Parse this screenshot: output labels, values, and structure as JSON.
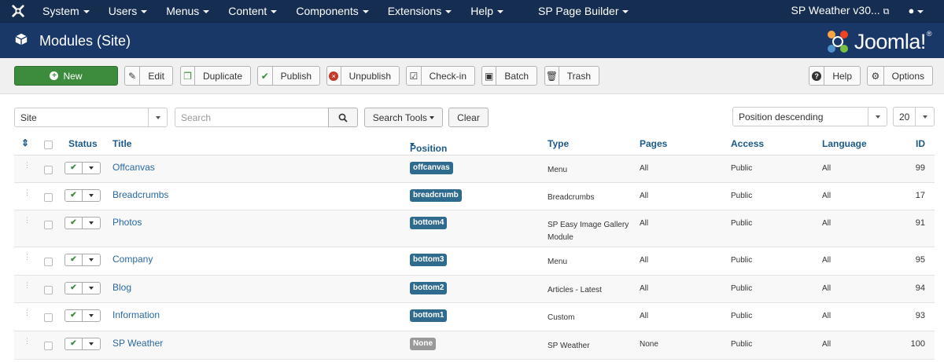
{
  "navbar": {
    "menu": [
      "System",
      "Users",
      "Menus",
      "Content",
      "Components",
      "Extensions",
      "Help",
      "SP Page Builder"
    ],
    "site_link": "SP Weather v30...",
    "colors": {
      "bar": "#152d50",
      "header": "#1a3867",
      "accent": "#3d8c3d"
    }
  },
  "header": {
    "title": "Modules (Site)",
    "brand": "Joomla!",
    "brand_mark": "®"
  },
  "toolbar": {
    "new": "New",
    "edit": "Edit",
    "duplicate": "Duplicate",
    "publish": "Publish",
    "unpublish": "Unpublish",
    "checkin": "Check-in",
    "batch": "Batch",
    "trash": "Trash",
    "help": "Help",
    "options": "Options"
  },
  "filters": {
    "client": "Site",
    "search_placeholder": "Search",
    "search_tools": "Search Tools",
    "clear": "Clear",
    "ordering": "Position descending",
    "limit": "20"
  },
  "table": {
    "headers": {
      "status": "Status",
      "title": "Title",
      "position": "Position",
      "type": "Type",
      "pages": "Pages",
      "access": "Access",
      "language": "Language",
      "id": "ID"
    },
    "rows": [
      {
        "title": "Offcanvas",
        "position": "offcanvas",
        "type": "Menu",
        "pages": "All",
        "access": "Public",
        "language": "All",
        "id": "99"
      },
      {
        "title": "Breadcrumbs",
        "position": "breadcrumb",
        "type": "Breadcrumbs",
        "pages": "All",
        "access": "Public",
        "language": "All",
        "id": "17"
      },
      {
        "title": "Photos",
        "position": "bottom4",
        "type": "SP Easy Image Gallery Module",
        "pages": "All",
        "access": "Public",
        "language": "All",
        "id": "91"
      },
      {
        "title": "Company",
        "position": "bottom3",
        "type": "Menu",
        "pages": "All",
        "access": "Public",
        "language": "All",
        "id": "95"
      },
      {
        "title": "Blog",
        "position": "bottom2",
        "type": "Articles - Latest",
        "pages": "All",
        "access": "Public",
        "language": "All",
        "id": "94"
      },
      {
        "title": "Information",
        "position": "bottom1",
        "type": "Custom",
        "pages": "All",
        "access": "Public",
        "language": "All",
        "id": "93"
      },
      {
        "title": "SP Weather",
        "position": "None",
        "type": "SP Weather",
        "pages": "None",
        "access": "Public",
        "language": "All",
        "id": "100"
      }
    ]
  }
}
